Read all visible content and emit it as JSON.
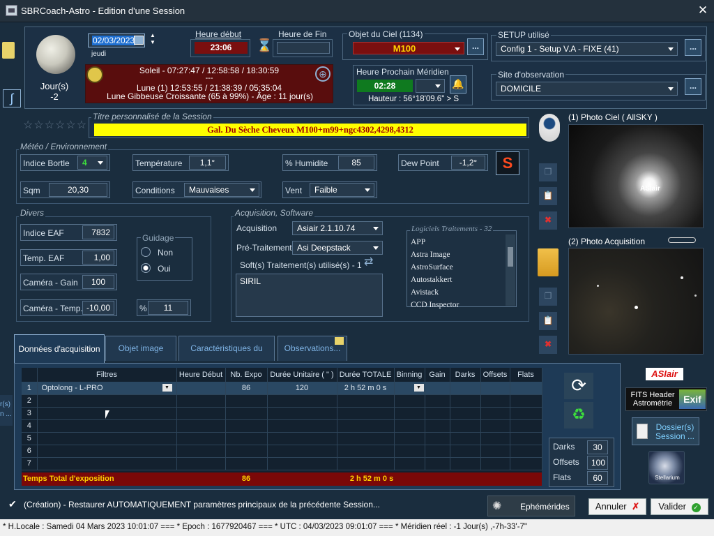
{
  "window": {
    "title": "SBRCoach-Astro - Edition d'une Session"
  },
  "moon": {
    "phase_label": "Jour(s)",
    "phase_value": "-2"
  },
  "session": {
    "date": "02/03/2023",
    "weekday": "jeudi",
    "heure_debut_label": "Heure début",
    "heure_debut": "23:06",
    "heure_fin_label": "Heure de Fin",
    "heure_fin": "",
    "objet_label": "Objet du Ciel (1134)",
    "objet": "M100",
    "setup_label": "SETUP utilisé",
    "setup": "Config 1 - Setup V.A - FIXE (41)",
    "site_label": "Site d'observation",
    "site": "DOMICILE",
    "meridien_label": "Heure Prochain Méridien",
    "meridien": "02:28",
    "hauteur": "Hauteur : 56°18'09.6\" > S",
    "soleil": "Soleil - 07:27:47 / 12:58:58 / 18:30:59",
    "dashes": "---",
    "lune": "Lune (1) 12:53:55 / 21:38:39 / 05:35:04",
    "lune_phase": "Lune Gibbeuse Croissante (65 à 99%) - Âge : 11 jour(s)",
    "titre_legend": "Titre personnalisé de la Session",
    "titre": "Gal. Du Sèche Cheveux M100+m99+ngc4302,4298,4312",
    "more_button": "..."
  },
  "meteo": {
    "legend": "Météo / Environnement",
    "bortle_label": "Indice Bortle",
    "bortle": "4",
    "temp_label": "Température",
    "temp": "1,1°",
    "humid_label": "% Humidite",
    "humid": "85",
    "dew_label": "Dew Point",
    "dew": "-1,2°",
    "sqm_label": "Sqm",
    "sqm": "20,30",
    "cond_label": "Conditions",
    "cond": "Mauvaises",
    "vent_label": "Vent",
    "vent": "Faible"
  },
  "divers": {
    "legend": "Divers",
    "eaf_label": "Indice EAF",
    "eaf": "7832",
    "teaf_label": "Temp. EAF",
    "teaf": "1,00",
    "gain_label": "Caméra - Gain",
    "gain": "100",
    "ctemp_label": "Caméra - Temp.",
    "ctemp": "-10,00",
    "guidage_legend": "Guidage",
    "non": "Non",
    "oui": "Oui",
    "pct_label": "%",
    "pct": "11"
  },
  "acq": {
    "legend": "Acquisition, Software",
    "acq_label": "Acquisition",
    "acq": "Asiair 2.1.10.74",
    "pre_label": "Pré-Traitement",
    "pre": "Asi Deepstack",
    "soft_label": "Soft(s) Traitement(s) utilisé(s) - 1",
    "soft_used": "SIRIL",
    "logiciels_legend": "Logiciels Traitements - 32",
    "logiciels": [
      "APP",
      "Astra Image",
      "AstroSurface",
      "Autostakkert",
      "Avistack",
      "CCD Inspector"
    ]
  },
  "photos": {
    "ciel": "(1) Photo Ciel ( AllSKY )",
    "acq": "(2) Photo Acquisition"
  },
  "tabs": [
    "Données d'acquisition",
    "Objet image",
    "Caractéristiques du Setup",
    "Observations..."
  ],
  "table": {
    "headers": [
      "Filtres",
      "Heure Début",
      "Nb. Expo",
      "Durée Unitaire ( \" )",
      "Durée TOTALE",
      "Binning",
      "Gain",
      "Darks",
      "Offsets",
      "Flats"
    ],
    "rows": [
      {
        "n": "1",
        "filtre": "Optolong - L-PRO",
        "debut": "",
        "expo": "86",
        "unit": "120",
        "total": "2 h 52 m 0 s"
      },
      {
        "n": "2"
      },
      {
        "n": "3"
      },
      {
        "n": "4"
      },
      {
        "n": "5"
      },
      {
        "n": "6"
      },
      {
        "n": "7"
      }
    ],
    "total_label": "Temps Total d'exposition",
    "total_expo": "86",
    "total_duree": "2 h 52 m 0 s"
  },
  "calib": {
    "darks_label": "Darks",
    "darks": "30",
    "offsets_label": "Offsets",
    "offsets": "100",
    "flats_label": "Flats",
    "flats": "60"
  },
  "right": {
    "fits": "FITS Header\nAstrométrie",
    "exif": "Exif",
    "dossier": "Dossier(s)\nSession ...",
    "asiair": "ASIair",
    "stellarium": "Stellarium"
  },
  "side_cut": "r(s)\nn ...",
  "footer": {
    "restore": "(Création) - Restaurer AUTOMATIQUEMENT paramètres principaux de la précédente Session...",
    "ephem": "Ephémérides",
    "annuler": "Annuler",
    "valider": "Valider"
  },
  "status": "* H.Locale : Samedi 04 Mars 2023 10:01:07  ===  * Epoch : 1677920467  ===  * UTC : 04/03/2023 09:01:07  ===  * Méridien réel : -1 Jour(s) ,-7h-33'-7\""
}
